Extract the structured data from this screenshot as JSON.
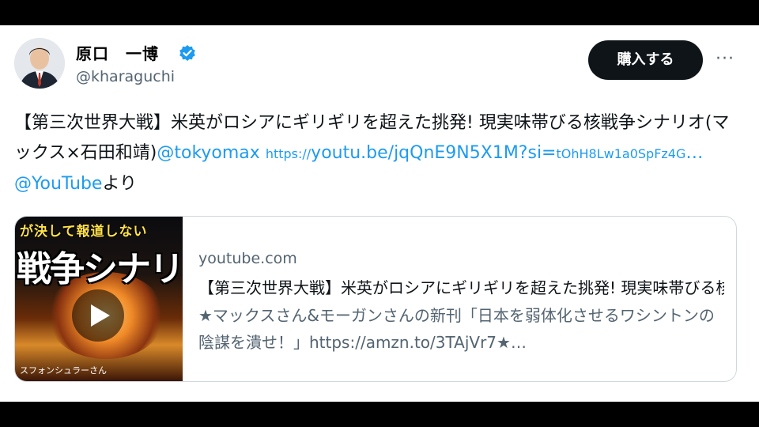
{
  "user": {
    "display_name": "原口　一博",
    "handle": "@kharaguchi",
    "verified_icon": "verified-badge-icon"
  },
  "header": {
    "subscribe_label": "購入する",
    "more_label": "···"
  },
  "tweet": {
    "text_main": "【第三次世界大戦】米英がロシアにギリギリを超えた挑発! 現実味帯びる核戦争シナリオ(マックス×石田和靖)",
    "mention_1": "@tokyomax",
    "url_prefix": "https://",
    "url_main": "youtu.be/jqQnE9N5X1M?si=",
    "url_small": "tOhH8Lw1a0SpFz4G",
    "url_ellipsis": "…",
    "mention_2": "@YouTube",
    "suffix": "より"
  },
  "link_card": {
    "domain": "youtube.com",
    "title": "【第三次世界大戦】米英がロシアにギリギリを超えた挑発! 現実味帯びる核戦争シナリオ",
    "description": "★マックスさん&モーガンさんの新刊「日本を弱体化させるワシントンの陰謀を潰せ！」https://amzn.to/3TAjVr7★…",
    "thumbnail": {
      "caption_top": "が決して報道しない",
      "caption_big": "戦争シナリ",
      "caption_bottom": "スフォンシュラーさん"
    }
  },
  "colors": {
    "link": "#1d9bf0",
    "text": "#0f1419",
    "muted": "#536471",
    "button_bg": "#0f1419"
  }
}
